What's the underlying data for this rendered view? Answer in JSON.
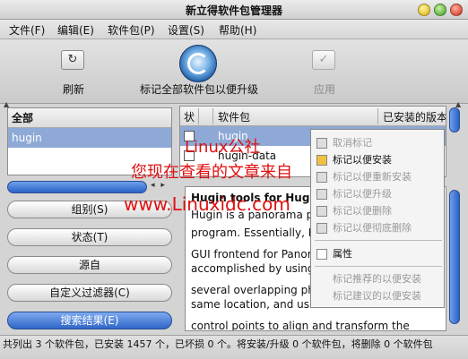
{
  "window": {
    "title": "新立得软件包管理器"
  },
  "menu": [
    "文件(F)",
    "编辑(E)",
    "软件包(P)",
    "设置(S)",
    "帮助(H)"
  ],
  "toolbar": {
    "refresh_label": "刷新",
    "mark_all_label": "标记全部软件包以便升级",
    "apply_label": "应用"
  },
  "groups": {
    "header": "全部",
    "items": [
      "hugin"
    ]
  },
  "side_buttons": [
    "组别(S)",
    "状态(T)",
    "源自",
    "自定义过滤器(C)",
    "搜索结果(E)"
  ],
  "package_table": {
    "columns": [
      "状",
      "软件包",
      "已安装的版本"
    ],
    "rows": [
      "hugin",
      "hugin-data"
    ]
  },
  "description": {
    "heading": "Hugin tools for Hugin",
    "lines": [
      "Hugin is a panorama p",
      "program. Essentially, H",
      "GUI frontend for Panor",
      "accomplished by using",
      "several overlapping ph",
      "same location, and usi",
      "control points to align and transform the"
    ]
  },
  "context_menu": {
    "items": [
      "取消标记",
      "标记以便安装",
      "标记以便重新安装",
      "标记以便升级",
      "标记以便删除",
      "标记以便彻底删除",
      "属性",
      "标记推荐的以便安装",
      "标记建议的以便安装"
    ]
  },
  "watermarks": [
    "Linux公社",
    "您现在查看的文章来自",
    "www.Linuxidc.com"
  ],
  "status": "共列出 3 个软件包，已安装 1457 个，已坏损 0 个。将安装/升级 0 个软件包，将删除 0 个软件包"
}
